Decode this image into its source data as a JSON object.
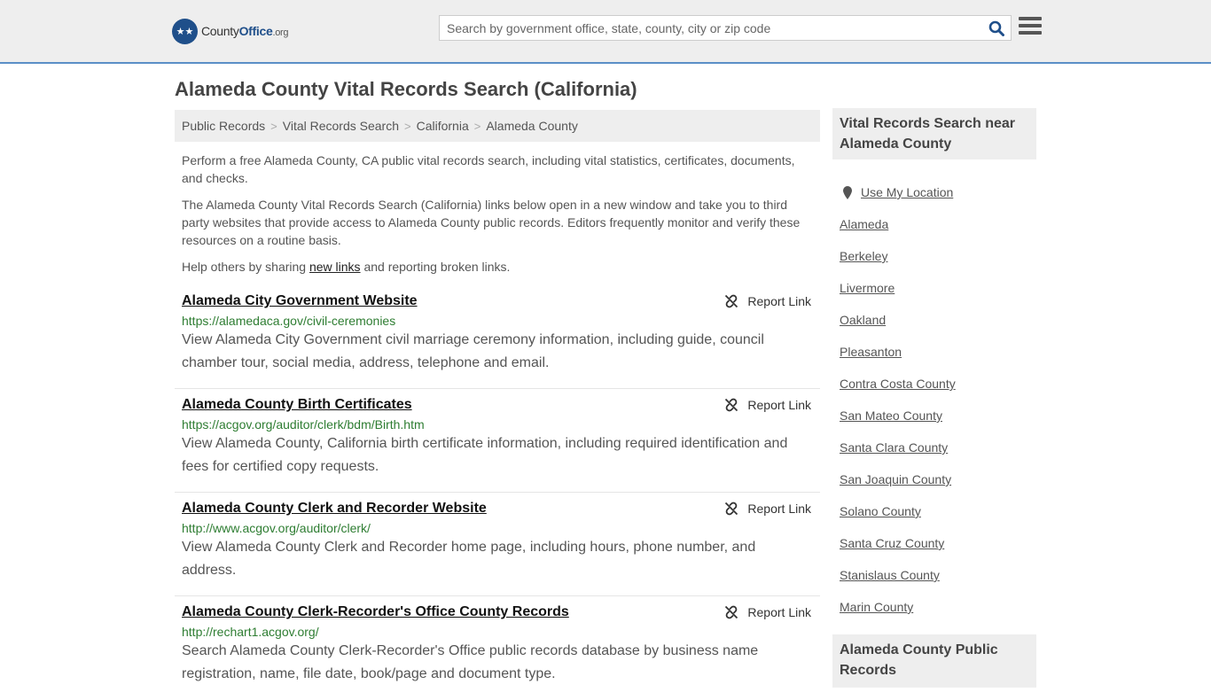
{
  "header": {
    "logo_text_a": "County",
    "logo_text_b": "Office",
    "logo_text_c": ".org",
    "search_placeholder": "Search by government office, state, county, city or zip code"
  },
  "page": {
    "title": "Alameda County Vital Records Search (California)"
  },
  "breadcrumb": [
    {
      "label": "Public Records"
    },
    {
      "label": "Vital Records Search"
    },
    {
      "label": "California"
    },
    {
      "label": "Alameda County"
    }
  ],
  "intro": {
    "p1": "Perform a free Alameda County, CA public vital records search, including vital statistics, certificates, documents, and checks.",
    "p2": "The Alameda County Vital Records Search (California) links below open in a new window and take you to third party websites that provide access to Alameda County public records. Editors frequently monitor and verify these resources on a routine basis.",
    "p3_pre": "Help others by sharing ",
    "p3_link": "new links",
    "p3_post": " and reporting broken links."
  },
  "report_label": "Report Link",
  "results": [
    {
      "title": "Alameda City Government Website",
      "url": "https://alamedaca.gov/civil-ceremonies",
      "desc": "View Alameda City Government civil marriage ceremony information, including guide, council chamber tour, social media, address, telephone and email."
    },
    {
      "title": "Alameda County Birth Certificates",
      "url": "https://acgov.org/auditor/clerk/bdm/Birth.htm",
      "desc": "View Alameda County, California birth certificate information, including required identification and fees for certified copy requests."
    },
    {
      "title": "Alameda County Clerk and Recorder Website",
      "url": "http://www.acgov.org/auditor/clerk/",
      "desc": "View Alameda County Clerk and Recorder home page, including hours, phone number, and address."
    },
    {
      "title": "Alameda County Clerk-Recorder's Office County Records",
      "url": "http://rechart1.acgov.org/",
      "desc": "Search Alameda County Clerk-Recorder's Office public records database by business name registration, name, file date, book/page and document type."
    }
  ],
  "sidebar": {
    "heading1": "Vital Records Search near Alameda County",
    "use_location": "Use My Location",
    "links": [
      "Alameda",
      "Berkeley",
      "Livermore",
      "Oakland",
      "Pleasanton",
      "Contra Costa County",
      "San Mateo County",
      "Santa Clara County",
      "San Joaquin County",
      "Solano County",
      "Santa Cruz County",
      "Stanislaus County",
      "Marin County"
    ],
    "heading2": "Alameda County Public Records"
  },
  "colors": {
    "header_bg": "#eeeeee",
    "accent_line": "#5b8fc7",
    "url_green": "#2e7d32",
    "brand_blue": "#1f4f8a"
  }
}
